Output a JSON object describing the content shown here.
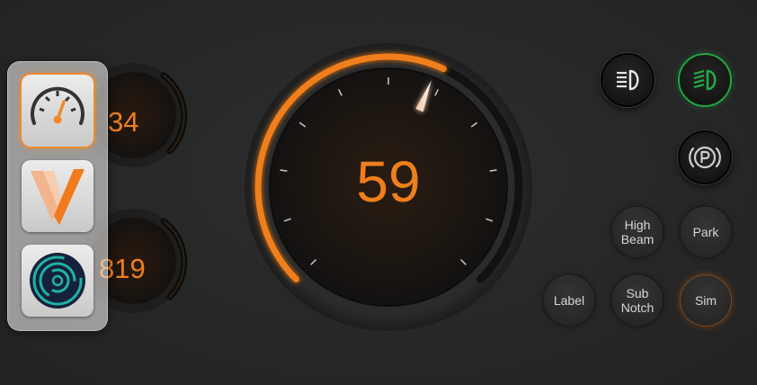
{
  "colors": {
    "accent": "#ef7f1a",
    "indicator_on": "#1ea83e",
    "button_text": "#d6d6d6"
  },
  "gauges": {
    "upper_small": {
      "value": "34"
    },
    "lower_small": {
      "value": "819"
    },
    "main": {
      "value": "59"
    }
  },
  "app_switcher": {
    "apps": [
      {
        "icon": "speedometer-app-icon",
        "active": true
      },
      {
        "icon": "v-logo-app-icon",
        "active": false
      },
      {
        "icon": "concentric-rings-app-icon",
        "active": false
      }
    ]
  },
  "indicators": [
    {
      "icon": "low-beam-icon",
      "on": false
    },
    {
      "icon": "high-beam-icon",
      "on": true
    },
    {
      "icon": "parking-brake-icon",
      "on": false
    }
  ],
  "buttons": {
    "high_beam": "High\nBeam",
    "park": "Park",
    "label": "Label",
    "sub_notch": "Sub\nNotch",
    "sim": "Sim"
  }
}
